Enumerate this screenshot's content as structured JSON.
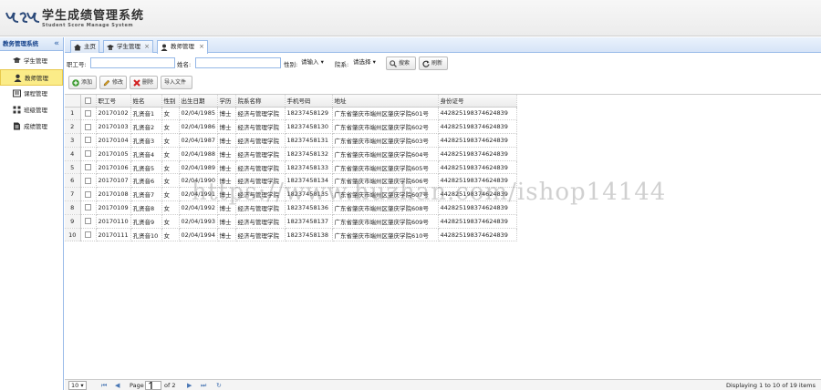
{
  "header": {
    "title": "学生成绩管理系统",
    "subtitle": "Student Score Manage System"
  },
  "sidebar": {
    "title": "教务管理系统",
    "items": [
      {
        "label": "学生管理",
        "icon": "student-icon"
      },
      {
        "label": "教师管理",
        "icon": "teacher-icon",
        "active": true
      },
      {
        "label": "课程管理",
        "icon": "course-icon"
      },
      {
        "label": "班级管理",
        "icon": "class-icon"
      },
      {
        "label": "成绩管理",
        "icon": "score-icon"
      }
    ]
  },
  "tabs": [
    {
      "label": "主页",
      "icon": "home-icon"
    },
    {
      "label": "学生管理",
      "icon": "student-icon",
      "closable": true
    },
    {
      "label": "教师管理",
      "icon": "teacher-icon",
      "closable": true,
      "selected": true
    }
  ],
  "search": {
    "teacher_no_label": "职工号:",
    "name_label": "姓名:",
    "gender_label": "性别:",
    "gender_value": "请输入",
    "dept_label": "院系:",
    "dept_value": "请选择",
    "search_button": "搜索",
    "refresh_button": "刷新"
  },
  "toolbar": {
    "add": "添加",
    "edit": "修改",
    "delete": "删除",
    "import": "导入文件"
  },
  "grid": {
    "columns": [
      "职工号",
      "姓名",
      "性别",
      "出生日期",
      "学历",
      "院系名称",
      "手机号码",
      "地址",
      "身份证号"
    ],
    "rows": [
      [
        "20170102",
        "孔贤音1",
        "女",
        "02/04/1985",
        "博士",
        "经济与管理学院",
        "18237458129",
        "广东省肇庆市端州区肇庆学院601号",
        "442825198374624839"
      ],
      [
        "20170103",
        "孔贤音2",
        "女",
        "02/04/1986",
        "博士",
        "经济与管理学院",
        "18237458130",
        "广东省肇庆市端州区肇庆学院602号",
        "442825198374624839"
      ],
      [
        "20170104",
        "孔贤音3",
        "女",
        "02/04/1987",
        "博士",
        "经济与管理学院",
        "18237458131",
        "广东省肇庆市端州区肇庆学院603号",
        "442825198374624839"
      ],
      [
        "20170105",
        "孔贤音4",
        "女",
        "02/04/1988",
        "博士",
        "经济与管理学院",
        "18237458132",
        "广东省肇庆市端州区肇庆学院604号",
        "442825198374624839"
      ],
      [
        "20170106",
        "孔贤音5",
        "女",
        "02/04/1989",
        "博士",
        "经济与管理学院",
        "18237458133",
        "广东省肇庆市端州区肇庆学院605号",
        "442825198374624839"
      ],
      [
        "20170107",
        "孔贤音6",
        "女",
        "02/04/1990",
        "博士",
        "经济与管理学院",
        "18237458134",
        "广东省肇庆市端州区肇庆学院606号",
        "442825198374624839"
      ],
      [
        "20170108",
        "孔贤音7",
        "女",
        "02/04/1991",
        "博士",
        "经济与管理学院",
        "18237458135",
        "广东省肇庆市端州区肇庆学院607号",
        "442825198374624839"
      ],
      [
        "20170109",
        "孔贤音8",
        "女",
        "02/04/1992",
        "博士",
        "经济与管理学院",
        "18237458136",
        "广东省肇庆市端州区肇庆学院608号",
        "442825198374624839"
      ],
      [
        "20170110",
        "孔贤音9",
        "女",
        "02/04/1993",
        "博士",
        "经济与管理学院",
        "18237458137",
        "广东省肇庆市端州区肇庆学院609号",
        "442825198374624839"
      ],
      [
        "20170111",
        "孔贤音10",
        "女",
        "02/04/1994",
        "博士",
        "经济与管理学院",
        "18237458138",
        "广东省肇庆市端州区肇庆学院610号",
        "442825198374624839"
      ]
    ]
  },
  "pager": {
    "page_size": "10",
    "page_label": "Page",
    "page_value": "1",
    "of_label": "of 2",
    "display_text": "Displaying 1 to 10 of 19 items"
  },
  "watermark": "https://www.huzhan.com/ishop14144",
  "colors": {
    "accent_border": "#99bbe8",
    "active_item": "#fbec88",
    "title_text": "#15428b"
  }
}
